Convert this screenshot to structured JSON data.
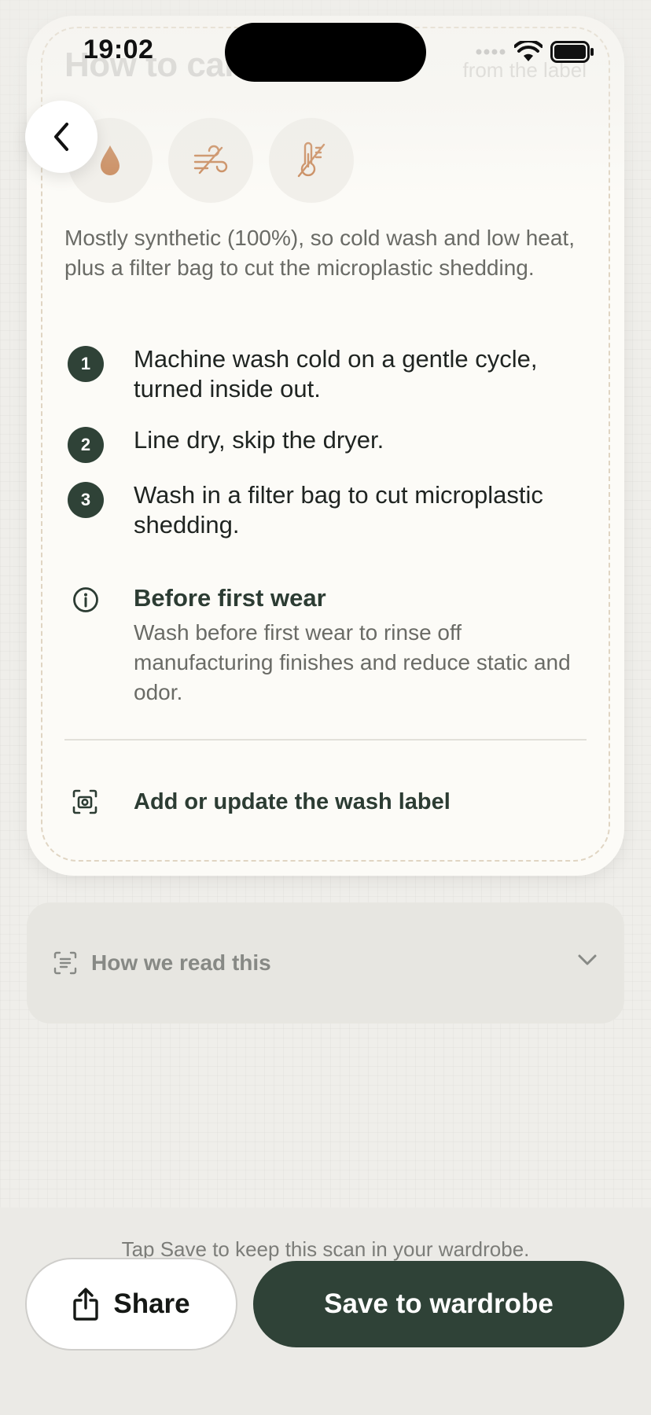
{
  "status_bar": {
    "time": "19:02"
  },
  "header": {
    "title": "How to care for it",
    "subtitle": "from the label"
  },
  "care_icons": [
    "water-drop-icon",
    "air-dry-icon",
    "low-heat-thermometer-icon"
  ],
  "summary": "Mostly synthetic (100%), so cold wash and low heat, plus a filter bag to cut the microplastic shedding.",
  "steps": [
    {
      "number": "1",
      "text": "Machine wash cold on a gentle cycle, turned inside out."
    },
    {
      "number": "2",
      "text": "Line dry, skip the dryer."
    },
    {
      "number": "3",
      "text": "Wash in a filter bag to cut microplastic shedding."
    }
  ],
  "tip": {
    "title": "Before first wear",
    "body": "Wash before first wear to rinse off manufacturing finishes and reduce static and odor."
  },
  "label_action": {
    "label": "Add or update the wash label"
  },
  "read_panel": {
    "label": "How we read this"
  },
  "bottom": {
    "hint": "Tap Save to keep this scan in your wardrobe.",
    "share_label": "Share",
    "save_label": "Save to wardrobe"
  },
  "colors": {
    "primary": "#2f4237",
    "accent_icon": "#c98a5c",
    "background": "#efeeea",
    "card": "#fcfbf7"
  }
}
